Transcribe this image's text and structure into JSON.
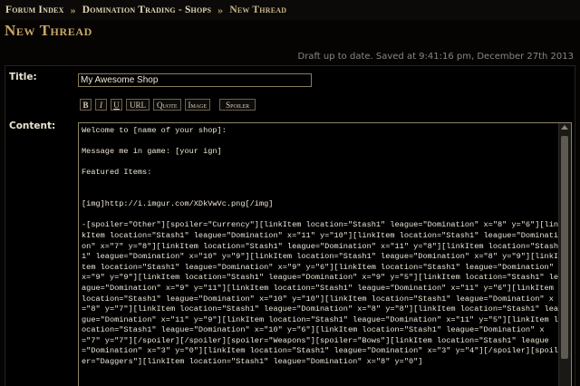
{
  "breadcrumb": {
    "items": [
      "Forum Index",
      "Domination Trading - Shops",
      "New Thread"
    ],
    "separator": "»"
  },
  "page_title": "New Thread",
  "draft_status": "Draft up to date. Saved at 9:41:16 pm, December 27th 2013",
  "form": {
    "title_label": "Title:",
    "title_value": "My Awesome Shop",
    "content_label": "Content:",
    "toolbar": {
      "bold": "B",
      "italic": "I",
      "underline": "U",
      "url": "URL",
      "quote": "Quote",
      "image": "Image",
      "spoiler": "Spoiler"
    },
    "content_text": "Welcome to [name of your shop]:\n\nMessage me in game: [your ign]\n\nFeatured Items:\n\n\n[img]http://i.imgur.com/XDkVwVc.png[/img]\n\n-[spoiler=\"Other\"][spoiler=\"Currency\"][linkItem location=\"Stash1\" league=\"Domination\" x=\"8\" y=\"6\"][linkItem location=\"Stash1\" league=\"Domination\" x=\"11\" y=\"10\"][linkItem location=\"Stash1\" league=\"Domination\" x=\"7\" y=\"8\"][linkItem location=\"Stash1\" league=\"Domination\" x=\"11\" y=\"8\"][linkItem location=\"Stash1\" league=\"Domination\" x=\"10\" y=\"9\"][linkItem location=\"Stash1\" league=\"Domination\" x=\"8\" y=\"9\"][linkItem location=\"Stash1\" league=\"Domination\" x=\"9\" y=\"6\"][linkItem location=\"Stash1\" league=\"Domination\" x=\"9\" y=\"9\"][linkItem location=\"Stash1\" league=\"Domination\" x=\"9\" y=\"5\"][linkItem location=\"Stash1\" league=\"Domination\" x=\"9\" y=\"11\"][linkItem location=\"Stash1\" league=\"Domination\" x=\"11\" y=\"6\"][linkItem location=\"Stash1\" league=\"Domination\" x=\"10\" y=\"10\"][linkItem location=\"Stash1\" league=\"Domination\" x=\"8\" y=\"7\"][linkItem location=\"Stash1\" league=\"Domination\" x=\"8\" y=\"8\"][linkItem location=\"Stash1\" league=\"Domination\" x=\"11\" y=\"9\"][linkItem location=\"Stash1\" league=\"Domination\" x=\"11\" y=\"5\"][linkItem location=\"Stash1\" league=\"Domination\" x=\"10\" y=\"6\"][linkItem location=\"Stash1\" league=\"Domination\" x=\"7\" y=\"7\"][/spoiler][/spoiler][spoiler=\"Weapons\"][spoiler=\"Bows\"][linkItem location=\"Stash1\" league=\"Domination\" x=\"3\" y=\"0\"][linkItem location=\"Stash1\" league=\"Domination\" x=\"3\" y=\"4\"][/spoiler][spoiler=\"Daggers\"][linkItem location=\"Stash1\" league=\"Domination\" x=\"8\" y=\"0\"]"
  }
}
